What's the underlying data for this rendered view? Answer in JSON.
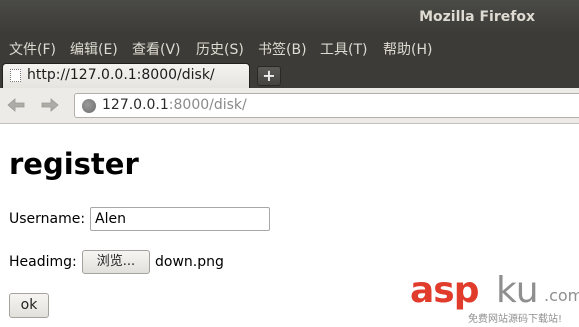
{
  "window": {
    "title": "Mozilla Firefox"
  },
  "menubar": {
    "items": [
      {
        "label": "文件(F)"
      },
      {
        "label": "编辑(E)"
      },
      {
        "label": "查看(V)"
      },
      {
        "label": "历史(S)"
      },
      {
        "label": "书签(B)"
      },
      {
        "label": "工具(T)"
      },
      {
        "label": "帮助(H)"
      }
    ]
  },
  "tabs": [
    {
      "label": "http://127.0.0.1:8000/disk/"
    }
  ],
  "newtab": {
    "label": "+"
  },
  "navbar": {
    "back_icon": "back-arrow-icon",
    "forward_icon": "forward-arrow-icon",
    "url_host": "127.0.0.1",
    "url_rest": ":8000/disk/"
  },
  "page": {
    "heading": "register",
    "username_label": "Username:",
    "username_value": "Alen",
    "headimg_label": "Headimg:",
    "browse_label": "浏览...",
    "file_name": "down.png",
    "submit_label": "ok"
  },
  "watermark": {
    "asp": "asp",
    "ku": "ku",
    "com": ".com",
    "subtitle": "免费网站源码下载站!"
  },
  "colors": {
    "titlebar": "#3c3b37",
    "title_text": "#dfdbd2",
    "watermark_red": "#e13b2b",
    "watermark_gray": "#8f8f8f"
  }
}
